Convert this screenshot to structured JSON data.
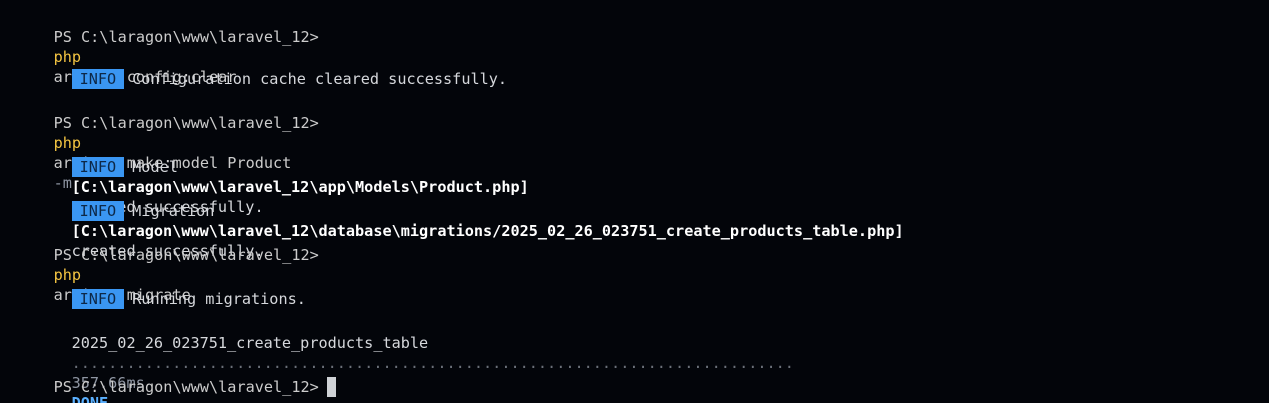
{
  "prompt": "PS C:\\laragon\\www\\laravel_12>",
  "commands": [
    {
      "php": "php",
      "args": "artisan config:clear",
      "flag": ""
    },
    {
      "php": "php",
      "args": "artisan make:model Product",
      "flag": "-m"
    },
    {
      "php": "php",
      "args": "artisan migrate",
      "flag": ""
    }
  ],
  "info_badge": "INFO",
  "outputs": {
    "config_clear": "Configuration cache cleared successfully.",
    "model": {
      "prefix": "Model",
      "path": "[C:\\laragon\\www\\laravel_12\\app\\Models\\Product.php]",
      "suffix": "created successfully."
    },
    "migration": {
      "prefix": "Migration",
      "path": "[C:\\laragon\\www\\laravel_12\\database\\migrations/2025_02_26_023751_create_products_table.php]",
      "suffix": "created successfully."
    },
    "running": "Running migrations.",
    "migrated": {
      "name": "2025_02_26_023751_create_products_table",
      "dots": "...............................................................................",
      "time": "357.66ms",
      "status": "DONE"
    }
  }
}
